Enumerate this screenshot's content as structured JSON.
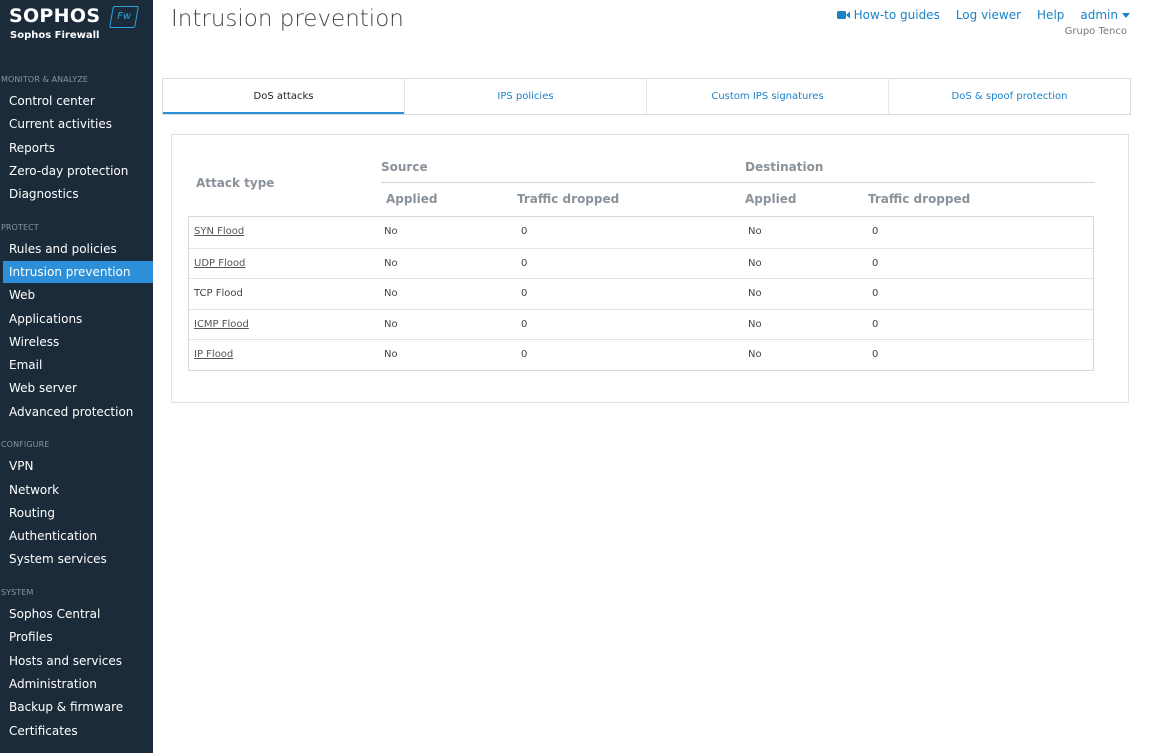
{
  "brand": {
    "logo_word": "SOPHOS",
    "badge": "Fw",
    "product": "Sophos Firewall"
  },
  "sidebar": {
    "sections": [
      {
        "title": "MONITOR & ANALYZE",
        "items": [
          "Control center",
          "Current activities",
          "Reports",
          "Zero-day protection",
          "Diagnostics"
        ]
      },
      {
        "title": "PROTECT",
        "items": [
          "Rules and policies",
          "Intrusion prevention",
          "Web",
          "Applications",
          "Wireless",
          "Email",
          "Web server",
          "Advanced protection"
        ]
      },
      {
        "title": "CONFIGURE",
        "items": [
          "VPN",
          "Network",
          "Routing",
          "Authentication",
          "System services"
        ]
      },
      {
        "title": "SYSTEM",
        "items": [
          "Sophos Central",
          "Profiles",
          "Hosts and services",
          "Administration",
          "Backup & firmware",
          "Certificates"
        ]
      }
    ],
    "active_item": "Intrusion prevention"
  },
  "header": {
    "title": "Intrusion prevention",
    "how_to": "How-to guides",
    "log_viewer": "Log viewer",
    "help": "Help",
    "user": "admin",
    "org": "Grupo Tenco"
  },
  "tabs": [
    "DoS attacks",
    "IPS policies",
    "Custom IPS signatures",
    "DoS & spoof protection"
  ],
  "active_tab": "DoS attacks",
  "table": {
    "attack_type_header": "Attack type",
    "source_header": "Source",
    "destination_header": "Destination",
    "applied_header": "Applied",
    "dropped_header": "Traffic dropped",
    "rows": [
      {
        "name": "SYN Flood",
        "link": true,
        "src_applied": "No",
        "src_dropped": "0",
        "dst_applied": "No",
        "dst_dropped": "0"
      },
      {
        "name": "UDP Flood",
        "link": true,
        "src_applied": "No",
        "src_dropped": "0",
        "dst_applied": "No",
        "dst_dropped": "0"
      },
      {
        "name": "TCP Flood",
        "link": false,
        "src_applied": "No",
        "src_dropped": "0",
        "dst_applied": "No",
        "dst_dropped": "0"
      },
      {
        "name": "ICMP Flood",
        "link": true,
        "src_applied": "No",
        "src_dropped": "0",
        "dst_applied": "No",
        "dst_dropped": "0"
      },
      {
        "name": "IP Flood",
        "link": true,
        "src_applied": "No",
        "src_dropped": "0",
        "dst_applied": "No",
        "dst_dropped": "0"
      }
    ]
  },
  "colors": {
    "sidebar_bg": "#1b2b3a",
    "accent": "#2c8fd8",
    "link": "#1a83c6"
  }
}
